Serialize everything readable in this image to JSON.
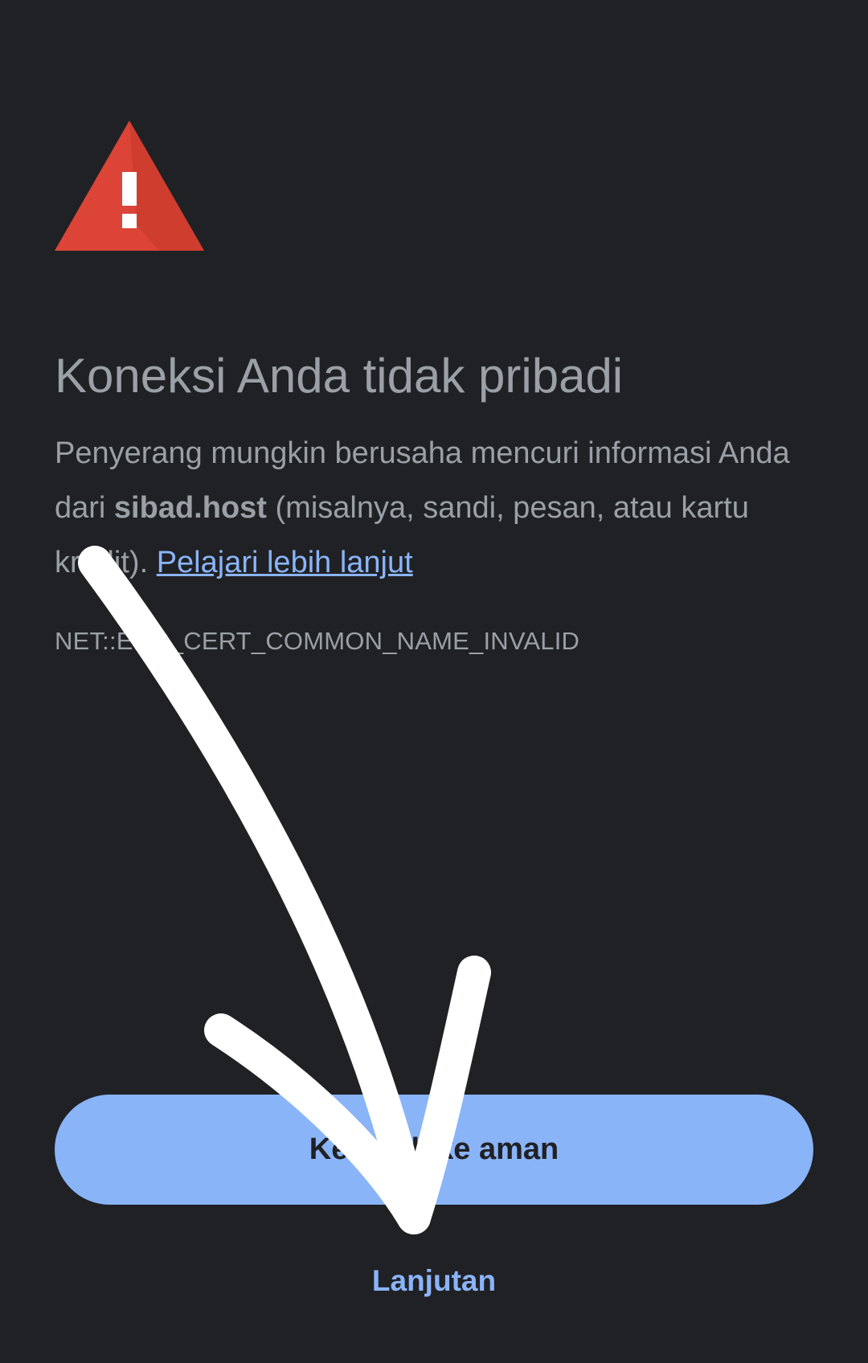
{
  "header": {
    "title": "Koneksi Anda tidak pribadi"
  },
  "message": {
    "prefix": "Penyerang mungkin berusaha mencuri informasi Anda dari ",
    "host": "sibad.host",
    "suffix": " (misalnya, sandi, pesan, atau kartu kredit). ",
    "learn_more": "Pelajari lebih lanjut"
  },
  "error_code": "NET::ERR_CERT_COMMON_NAME_INVALID",
  "actions": {
    "primary_label": "Kembali ke aman",
    "advanced_label": "Lanjutan"
  },
  "icons": {
    "warning": "warning-triangle-icon",
    "annotation": "hand-drawn-arrow"
  },
  "colors": {
    "background": "#202124",
    "warning_red": "#db4437",
    "accent_blue": "#8ab4f8",
    "text_grey": "#9aa0a6",
    "arrow_white": "#ffffff"
  }
}
